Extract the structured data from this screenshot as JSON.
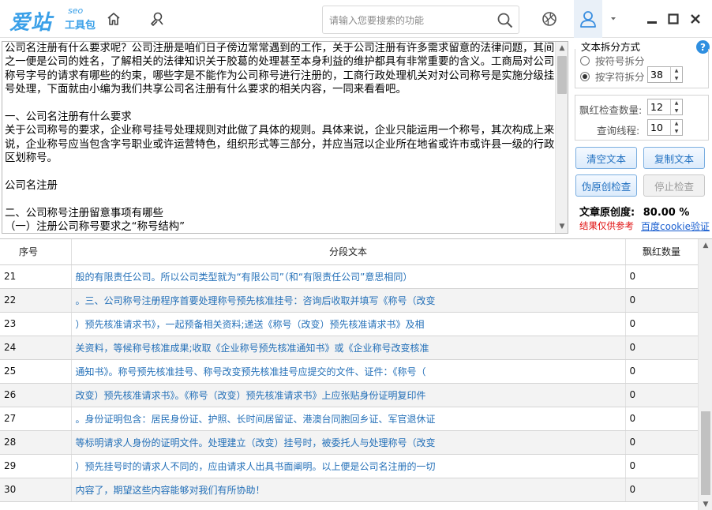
{
  "app": {
    "logo_main": "爱站",
    "logo_seo": "seo",
    "logo_sub": "工具包"
  },
  "icons": {
    "home": "home-icon",
    "tools": "tools-icon",
    "search": "search-icon",
    "browser": "globe-icon",
    "user": "user-icon",
    "dropdown": "chevron-down-icon",
    "minimize": "minimize-icon",
    "maximize": "maximize-icon",
    "close": "close-icon",
    "help": "help-icon"
  },
  "search": {
    "placeholder": "请输入您要搜索的功能"
  },
  "editor": {
    "text": "公司名注册有什么要求呢？公司注册是咱们日子傍边常常遇到的工作，关于公司注册有许多需求留意的法律问题，其间之一便是公司的姓名，了解相关的法律知识关于胶葛的处理甚至本身利益的维护都具有非常重要的含义。工商局对公司称号字号的请求有哪些的约束，哪些字是不能作为公司称号进行注册的，工商行政处理机关对对公司称号是实施分级挂号处理，下面就由小编为我们共享公司名注册有什么要求的相关内容，一同来看看吧。\n\n一、公司名注册有什么要求\n关于公司称号的要求，企业称号挂号处理规则对此做了具体的规则。具体来说，企业只能运用一个称号，其次构成上来说，企业称号应当包含字号职业或许运营特色，组织形式等三部分，并应当冠以企业所在地省或许市或许县一级的行政区划称号。\n\n公司名注册\n\n二、公司称号注册留意事项有哪些\n（一）注册公司称号要求之“称号结构”"
  },
  "panel": {
    "split_mode_label": "文本拆分方式",
    "split_by_symbol": "按符号拆分",
    "split_by_chars": "按字符拆分",
    "chars_value": "38",
    "red_count_label": "飘红检查数量:",
    "red_count_value": "12",
    "threads_label": "查询线程:",
    "threads_value": "10",
    "clear_btn": "清空文本",
    "copy_btn": "复制文本",
    "check_btn": "伪原创检查",
    "stop_btn": "停止检查",
    "originality_label": "文章原创度:",
    "originality_value": "80.00 %",
    "warning": "结果仅供参考",
    "cookie_link": "百度cookie验证"
  },
  "table": {
    "headers": [
      "序号",
      "分段文本",
      "飘红数量"
    ],
    "rows": [
      {
        "no": "21",
        "text": "般的有限责任公司。所以公司类型就为“有限公司”（和“有限责任公司”意思相同）",
        "count": "0"
      },
      {
        "no": "22",
        "text": "。三、公司称号注册程序首要处理称号预先核准挂号：咨询后收取并填写《称号（改变",
        "count": "0"
      },
      {
        "no": "23",
        "text": "）预先核准请求书》，一起预备相关资料;递送《称号（改变）预先核准请求书》及相",
        "count": "0"
      },
      {
        "no": "24",
        "text": "关资料，等候称号核准成果;收取《企业称号预先核准通知书》或《企业称号改变核准",
        "count": "0"
      },
      {
        "no": "25",
        "text": "通知书》。称号预先核准挂号、称号改变预先核准挂号应提交的文件、证件：《称号（",
        "count": "0"
      },
      {
        "no": "26",
        "text": "改变）预先核准请求书》。《称号（改变）预先核准请求书》上应张贴身份证明复印件",
        "count": "0"
      },
      {
        "no": "27",
        "text": "。身份证明包含：居民身份证、护照、长时间居留证、港澳台同胞回乡证、军官退休证",
        "count": "0"
      },
      {
        "no": "28",
        "text": "等标明请求人身份的证明文件。处理建立（改变）挂号时，被委托人与处理称号（改变",
        "count": "0"
      },
      {
        "no": "29",
        "text": "）预先挂号时的请求人不同的，应由请求人出具书面阐明。以上便是公司名注册的一切",
        "count": "0"
      },
      {
        "no": "30",
        "text": "内容了，期望这些内容能够对我们有所协助！",
        "count": "0"
      }
    ]
  }
}
